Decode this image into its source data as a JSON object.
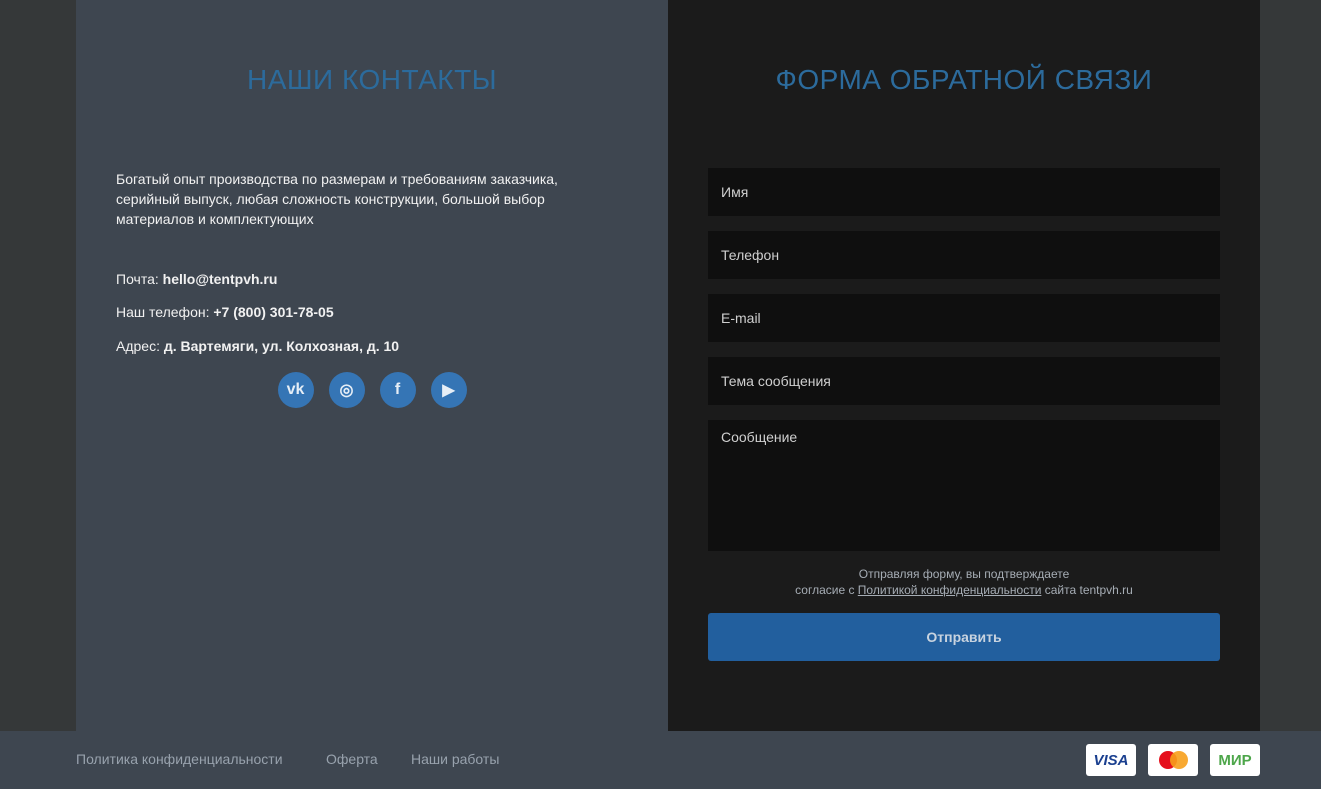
{
  "contacts": {
    "title": "НАШИ КОНТАКТЫ",
    "description": "Богатый опыт производства по размерам и требованиям заказчика, серийный выпуск, любая сложность конструкции, большой выбор материалов и комплектующих",
    "email_label": "Почта:",
    "email": "hello@tentpvh.ru",
    "phone_label": "Наш телефон:",
    "phone": "+7 (800) 301-78-05",
    "address_label": "Адрес:",
    "address": "д. Вартемяги, ул. Колхозная, д. 10",
    "socials": [
      {
        "icon": "vk-icon",
        "glyph": "vk"
      },
      {
        "icon": "instagram-icon",
        "glyph": "◎"
      },
      {
        "icon": "facebook-icon",
        "glyph": "f"
      },
      {
        "icon": "youtube-icon",
        "glyph": "▶"
      }
    ]
  },
  "form": {
    "title": "ФОРМА ОБРАТНОЙ СВЯЗИ",
    "name_placeholder": "Имя",
    "phone_placeholder": "Телефон",
    "email_placeholder": "E-mail",
    "subject_placeholder": "Тема сообщения",
    "message_placeholder": "Сообщение",
    "consent_line1": "Отправляя форму, вы подтверждаете",
    "consent_pre": "согласие с ",
    "consent_link": "Политикой конфиденциальности",
    "consent_post": " сайта tentpvh.ru",
    "submit": "Отправить"
  },
  "footer": {
    "links": [
      "Политика конфиденциальности",
      "Оферта",
      "Наши работы"
    ],
    "payments": [
      "VISA",
      "mastercard",
      "МИР"
    ]
  },
  "colors": {
    "accent": "#2c6b9c",
    "button": "#225f9e"
  }
}
